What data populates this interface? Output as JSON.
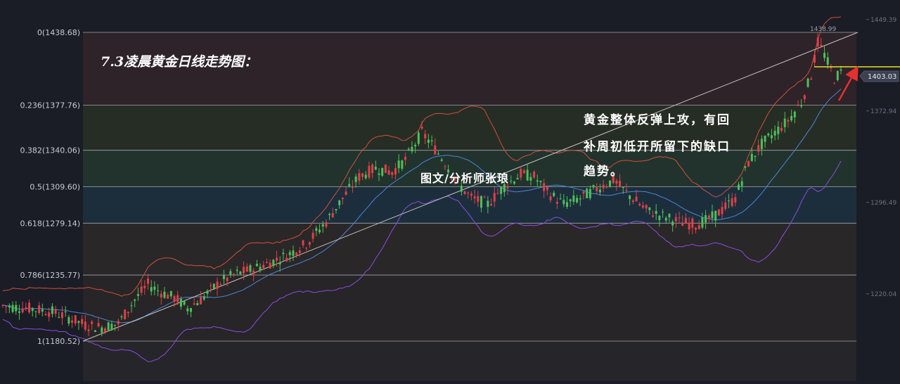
{
  "chart_data": {
    "type": "candlestick",
    "title": "7.3凌晨黄金日线走势图：",
    "author": "图文/分析师张琅",
    "annotation_lines": [
      "黄金整体反弹上攻，有回",
      "补周初低开所留下的缺口",
      "趋势。"
    ],
    "fibonacci_levels": [
      {
        "label": "0(1438.68)",
        "ratio": 0,
        "price": 1438.68
      },
      {
        "label": "0.236(1377.76)",
        "ratio": 0.236,
        "price": 1377.76
      },
      {
        "label": "0.382(1340.06)",
        "ratio": 0.382,
        "price": 1340.06
      },
      {
        "label": "0.5(1309.60)",
        "ratio": 0.5,
        "price": 1309.6
      },
      {
        "label": "0.618(1279.14)",
        "ratio": 0.618,
        "price": 1279.14
      },
      {
        "label": "0.786(1235.77)",
        "ratio": 0.786,
        "price": 1235.77
      },
      {
        "label": "1(1180.52)",
        "ratio": 1,
        "price": 1180.52
      }
    ],
    "right_axis_ticks": [
      "1449.39",
      "1372.94",
      "1296.49",
      "1220.04"
    ],
    "right_axis_values": [
      1449.39,
      1372.94,
      1296.49,
      1220.04
    ],
    "high_label": "1438.99",
    "current_price": "1403.03",
    "current_price_value": 1403.03,
    "colors": {
      "up": "#e0404a",
      "down": "#4fbf5a",
      "upper_band": "#d0503c",
      "middle_band": "#4a86d8",
      "lower_band": "#8c4de0",
      "trendline": "#c9c3c0",
      "yellow_line": "#e8e020",
      "arrow": "#e53030"
    }
  }
}
